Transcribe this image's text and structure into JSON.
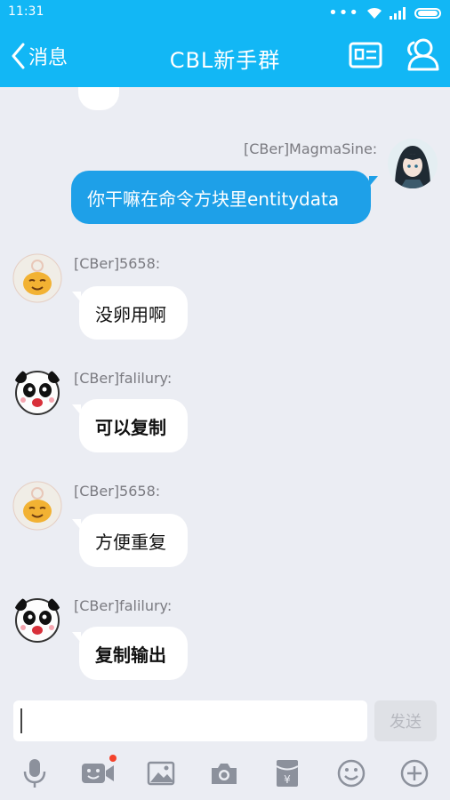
{
  "status_bar": {
    "time": "11:31"
  },
  "header": {
    "back_label": "消息",
    "title": "CBL新手群"
  },
  "messages": [
    {
      "sender": "[CBer]MagmaSine:",
      "text": "你干嘛在命令方块里entitydata",
      "self": true
    },
    {
      "sender": "[CBer]5658:",
      "text": "没卵用啊"
    },
    {
      "sender": "[CBer]falilury:",
      "text": "可以复制"
    },
    {
      "sender": "[CBer]5658:",
      "text": "方便重复"
    },
    {
      "sender": "[CBer]falilury:",
      "text": "复制输出"
    }
  ],
  "input": {
    "value": "",
    "send_label": "发送"
  },
  "toolbar": {
    "icons": [
      "microphone-icon",
      "video-icon",
      "image-icon",
      "camera-icon",
      "red-packet-icon",
      "emoji-icon",
      "plus-icon"
    ]
  },
  "colors": {
    "brand": "#12b7f5",
    "self_bubble": "#1ea0e8",
    "background": "#ebedf3",
    "notification_dot": "#f4432c"
  }
}
